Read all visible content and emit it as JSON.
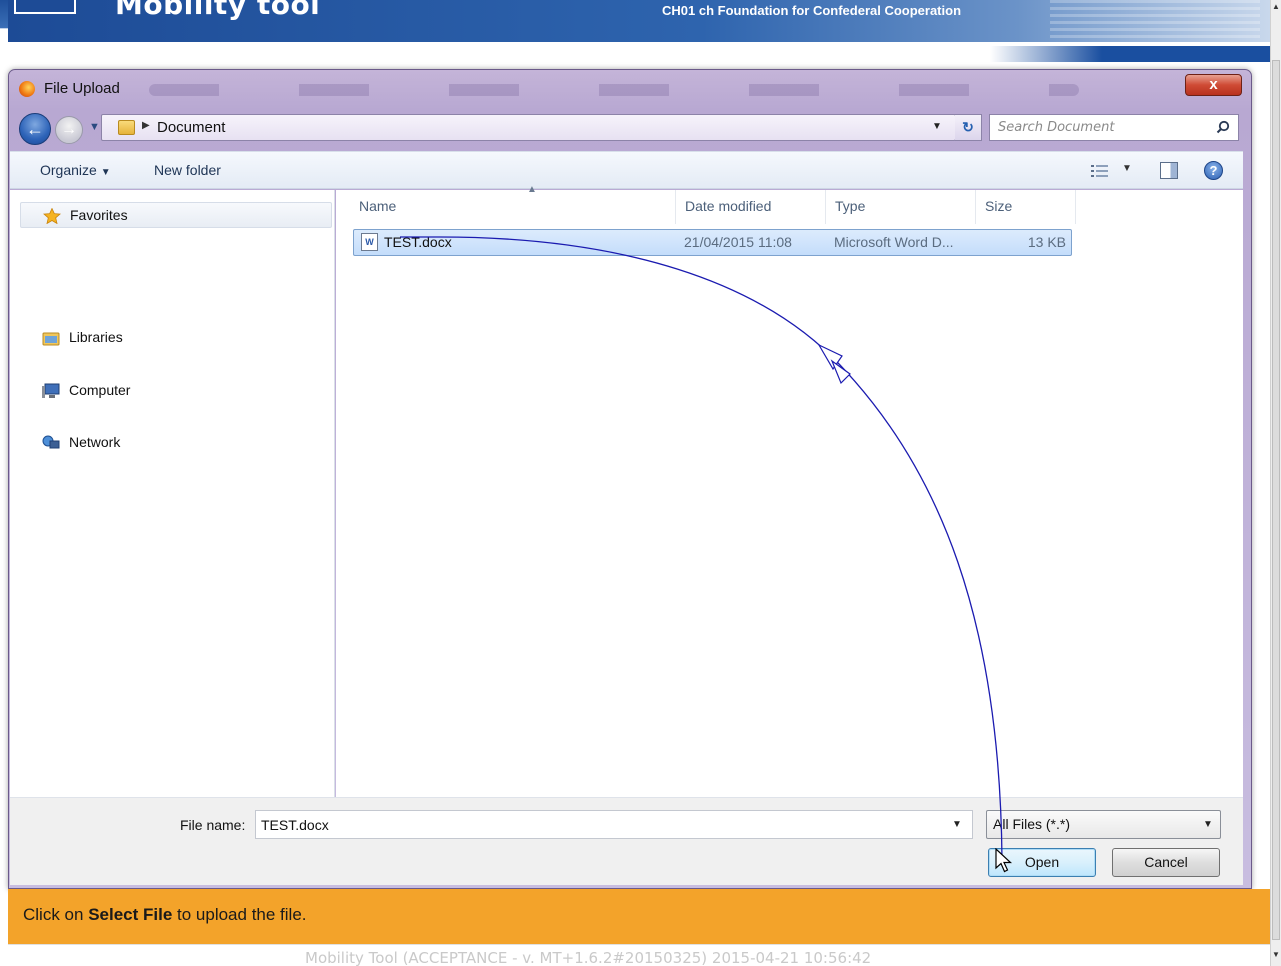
{
  "background_page": {
    "title": "Mobility tool",
    "organisation": "CH01 ch Foundation for Confederal Cooperation"
  },
  "dialog": {
    "title": "File Upload",
    "close_label": "x",
    "address": {
      "breadcrumb": "Document",
      "search_placeholder": "Search Document"
    },
    "toolbar": {
      "organize_label": "Organize",
      "new_folder_label": "New folder"
    },
    "nav_pane": {
      "items": [
        {
          "label": "Favorites",
          "icon": "star-icon"
        },
        {
          "label": "Libraries",
          "icon": "libraries-icon"
        },
        {
          "label": "Computer",
          "icon": "computer-icon"
        },
        {
          "label": "Network",
          "icon": "network-icon"
        }
      ]
    },
    "file_list": {
      "columns": [
        "Name",
        "Date modified",
        "Type",
        "Size"
      ],
      "rows": [
        {
          "name": "TEST.docx",
          "date_modified": "21/04/2015 11:08",
          "type": "Microsoft Word D...",
          "size": "13 KB",
          "icon": "word-document-icon",
          "selected": true
        }
      ]
    },
    "bottom": {
      "file_name_label": "File name:",
      "file_name_value": "TEST.docx",
      "file_type_value": "All Files (*.*)",
      "open_label": "Open",
      "cancel_label": "Cancel"
    }
  },
  "instruction": {
    "prefix": "Click on ",
    "emphasis": "Select File",
    "suffix": " to upload the file."
  },
  "footer": {
    "text": "Mobility Tool (ACCEPTANCE - v. MT+1.6.2#20150325) 2015-04-21 10:56:42"
  },
  "colors": {
    "banner": "#f3a32a",
    "annotation_arrow": "#1b1bb0",
    "selection": "#c4ddfb"
  }
}
